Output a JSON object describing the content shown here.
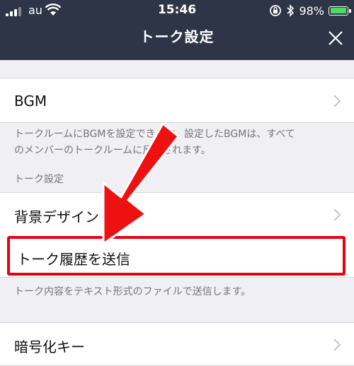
{
  "status_bar": {
    "carrier": "au",
    "time": "15:46",
    "battery_percent": "98%",
    "battery_level": 0.98
  },
  "header": {
    "title": "トーク設定",
    "close_icon": "close-icon"
  },
  "settings": {
    "bgm": {
      "label": "BGM",
      "note_line1": "トークルームにBGMを設定できます。設定したBGMは、すべて",
      "note_line2": "のメンバーのトークルームに反映されます。"
    },
    "section_header": "トーク設定",
    "background_design": {
      "label": "背景デザイン"
    },
    "send_history": {
      "label": "トーク履歴を送信",
      "note": "トーク内容をテキスト形式のファイルで送信します。"
    },
    "encryption_key": {
      "label": "暗号化キー"
    }
  },
  "colors": {
    "header_bg": "#2e3546",
    "highlight": "#e60012",
    "battery_fill": "#4cd964"
  }
}
